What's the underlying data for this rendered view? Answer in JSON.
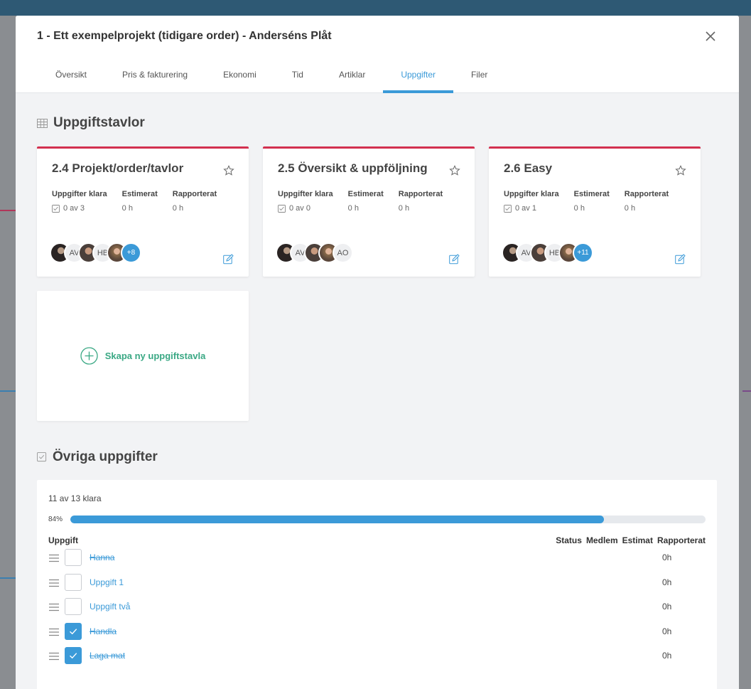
{
  "modal": {
    "title": "1 - Ett exempelprojekt (tidigare order) - Anderséns Plåt",
    "tabs": [
      {
        "label": "Översikt",
        "active": false
      },
      {
        "label": "Pris & fakturering",
        "active": false
      },
      {
        "label": "Ekonomi",
        "active": false
      },
      {
        "label": "Tid",
        "active": false
      },
      {
        "label": "Artiklar",
        "active": false
      },
      {
        "label": "Uppgifter",
        "active": true
      },
      {
        "label": "Filer",
        "active": false
      }
    ]
  },
  "boards_section": {
    "title": "Uppgiftstavlor",
    "stat_labels": [
      "Uppgifter klara",
      "Estimerat",
      "Rapporterat"
    ],
    "boards": [
      {
        "title": "2.4 Projekt/order/tavlor",
        "tasks_done": "0 av 3",
        "estimated": "0 h",
        "reported": "0 h",
        "avatars": [
          {
            "type": "photo-dark",
            "text": ""
          },
          {
            "type": "initials",
            "text": "AV"
          },
          {
            "type": "photo-bald",
            "text": ""
          },
          {
            "type": "initials",
            "text": "HB"
          },
          {
            "type": "photo-blonde",
            "text": ""
          },
          {
            "type": "more",
            "text": "+8"
          }
        ]
      },
      {
        "title": "2.5 Översikt & uppföljning",
        "tasks_done": "0 av 0",
        "estimated": "0 h",
        "reported": "0 h",
        "avatars": [
          {
            "type": "photo-dark",
            "text": ""
          },
          {
            "type": "initials",
            "text": "AV"
          },
          {
            "type": "photo-bald",
            "text": ""
          },
          {
            "type": "photo-blonde",
            "text": ""
          },
          {
            "type": "initials",
            "text": "AO"
          }
        ]
      },
      {
        "title": "2.6 Easy",
        "tasks_done": "0 av 1",
        "estimated": "0 h",
        "reported": "0 h",
        "avatars": [
          {
            "type": "photo-dark",
            "text": ""
          },
          {
            "type": "initials",
            "text": "AV"
          },
          {
            "type": "photo-bald",
            "text": ""
          },
          {
            "type": "initials",
            "text": "HB"
          },
          {
            "type": "photo-blonde",
            "text": ""
          },
          {
            "type": "more",
            "text": "+11"
          }
        ]
      }
    ],
    "new_board_label": "Skapa ny uppgiftstavla"
  },
  "tasks_section": {
    "title": "Övriga uppgifter",
    "done_count": "11 av 13 klara",
    "progress_label": "84%",
    "progress_value": 0.84,
    "columns": {
      "task": "Uppgift",
      "status": "Status",
      "member": "Medlem",
      "estimate": "Estimat",
      "reported": "Rapporterat"
    },
    "rows": [
      {
        "name": "Hanna",
        "checked": false,
        "strikethrough": true,
        "reported": "0h"
      },
      {
        "name": "Uppgift 1",
        "checked": false,
        "strikethrough": false,
        "reported": "0h"
      },
      {
        "name": "Uppgift två",
        "checked": false,
        "strikethrough": false,
        "reported": "0h"
      },
      {
        "name": "Handla",
        "checked": true,
        "strikethrough": true,
        "reported": "0h"
      },
      {
        "name": "Laga mat",
        "checked": true,
        "strikethrough": true,
        "reported": "0h"
      }
    ]
  },
  "colors": {
    "accent": "#3b9ad8",
    "board_top": "#d3304f",
    "create_green": "#3aa884"
  }
}
